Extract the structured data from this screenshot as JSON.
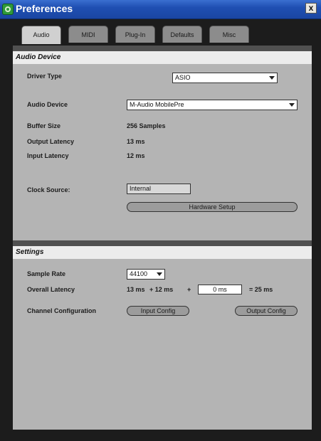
{
  "window": {
    "title": "Preferences",
    "close_label": "x",
    "app_icon": "app-logo-icon"
  },
  "tabs": [
    {
      "label": "Audio",
      "active": true
    },
    {
      "label": "MIDI",
      "active": false
    },
    {
      "label": "Plug-In",
      "active": false
    },
    {
      "label": "Defaults",
      "active": false
    },
    {
      "label": "Misc",
      "active": false
    }
  ],
  "audio_device": {
    "header": "Audio Device",
    "driver_type_label": "Driver Type",
    "driver_type_value": "ASIO",
    "device_label": "Audio Device",
    "device_value": "M-Audio MobilePre",
    "buffer_label": "Buffer Size",
    "buffer_value": "256 Samples",
    "output_latency_label": "Output Latency",
    "output_latency_value": "13 ms",
    "input_latency_label": "Input Latency",
    "input_latency_value": "12 ms",
    "clock_label": "Clock Source:",
    "clock_value": "Internal",
    "hardware_setup_label": "Hardware Setup"
  },
  "settings": {
    "header": "Settings",
    "sample_rate_label": "Sample Rate",
    "sample_rate_value": "44100",
    "overall_latency_label": "Overall Latency",
    "latency_part1": "13 ms",
    "latency_part2": "+ 12 ms",
    "latency_plus": "+",
    "latency_extra_value": "0 ms",
    "latency_total": "= 25 ms",
    "channel_config_label": "Channel Configuration",
    "input_config_label": "Input Config",
    "output_config_label": "Output Config"
  },
  "colors": {
    "titlebar": "#1f4fb2",
    "panel_bg": "#b4b4b4",
    "header_bg": "#ececec",
    "window_bg": "#1c1c1c"
  }
}
